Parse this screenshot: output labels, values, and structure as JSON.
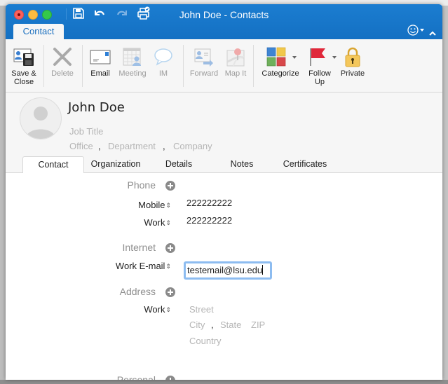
{
  "window": {
    "title": "John Doe - Contacts"
  },
  "quick_access": {
    "icons": [
      "save-icon",
      "undo-icon",
      "redo-icon",
      "print-icon"
    ]
  },
  "ribbon_tab": {
    "label": "Contact"
  },
  "ribbon": {
    "buttons": [
      {
        "label": "Save &\nClose",
        "label_line1": "Save &",
        "label_line2": "Close",
        "icon": "save-close-icon",
        "enabled": true
      },
      {
        "label": "Delete",
        "icon": "delete-icon",
        "enabled": false
      },
      {
        "label": "Email",
        "icon": "email-icon",
        "enabled": true
      },
      {
        "label": "Meeting",
        "icon": "meeting-icon",
        "enabled": false
      },
      {
        "label": "IM",
        "icon": "im-icon",
        "enabled": false
      },
      {
        "label": "Forward",
        "icon": "forward-icon",
        "enabled": false
      },
      {
        "label": "Map It",
        "icon": "map-icon",
        "enabled": false
      },
      {
        "label": "Categorize",
        "icon": "categorize-icon",
        "enabled": true
      },
      {
        "label_line1": "Follow",
        "label_line2": "Up",
        "icon": "flag-icon",
        "enabled": true
      },
      {
        "label": "Private",
        "icon": "lock-icon",
        "enabled": true
      }
    ]
  },
  "contact_header": {
    "name": "John  Doe",
    "job_title_placeholder": "Job Title",
    "office_placeholder": "Office",
    "department_placeholder": "Department",
    "company_placeholder": "Company",
    "separator": ","
  },
  "detail_tabs": [
    {
      "label": "Contact",
      "active": true
    },
    {
      "label": "Organization",
      "active": false
    },
    {
      "label": "Details",
      "active": false
    },
    {
      "label": "Notes",
      "active": false
    },
    {
      "label": "Certificates",
      "active": false
    }
  ],
  "sections": {
    "phone": {
      "title": "Phone",
      "entries": [
        {
          "label": "Mobile",
          "value": "222222222"
        },
        {
          "label": "Work",
          "value": "222222222"
        }
      ]
    },
    "internet": {
      "title": "Internet",
      "entries": [
        {
          "label": "Work E-mail",
          "value": "testemail@lsu.edu"
        }
      ]
    },
    "address": {
      "title": "Address",
      "label": "Work",
      "street_placeholder": "Street",
      "city_placeholder": "City",
      "state_placeholder": "State",
      "zip_placeholder": "ZIP",
      "country_placeholder": "Country",
      "separator": ","
    },
    "personal": {
      "title": "Personal"
    }
  },
  "colors": {
    "title_bar": "#1875c9",
    "accent": "#1a6fbf",
    "focus_ring": "#8dbcf0"
  }
}
